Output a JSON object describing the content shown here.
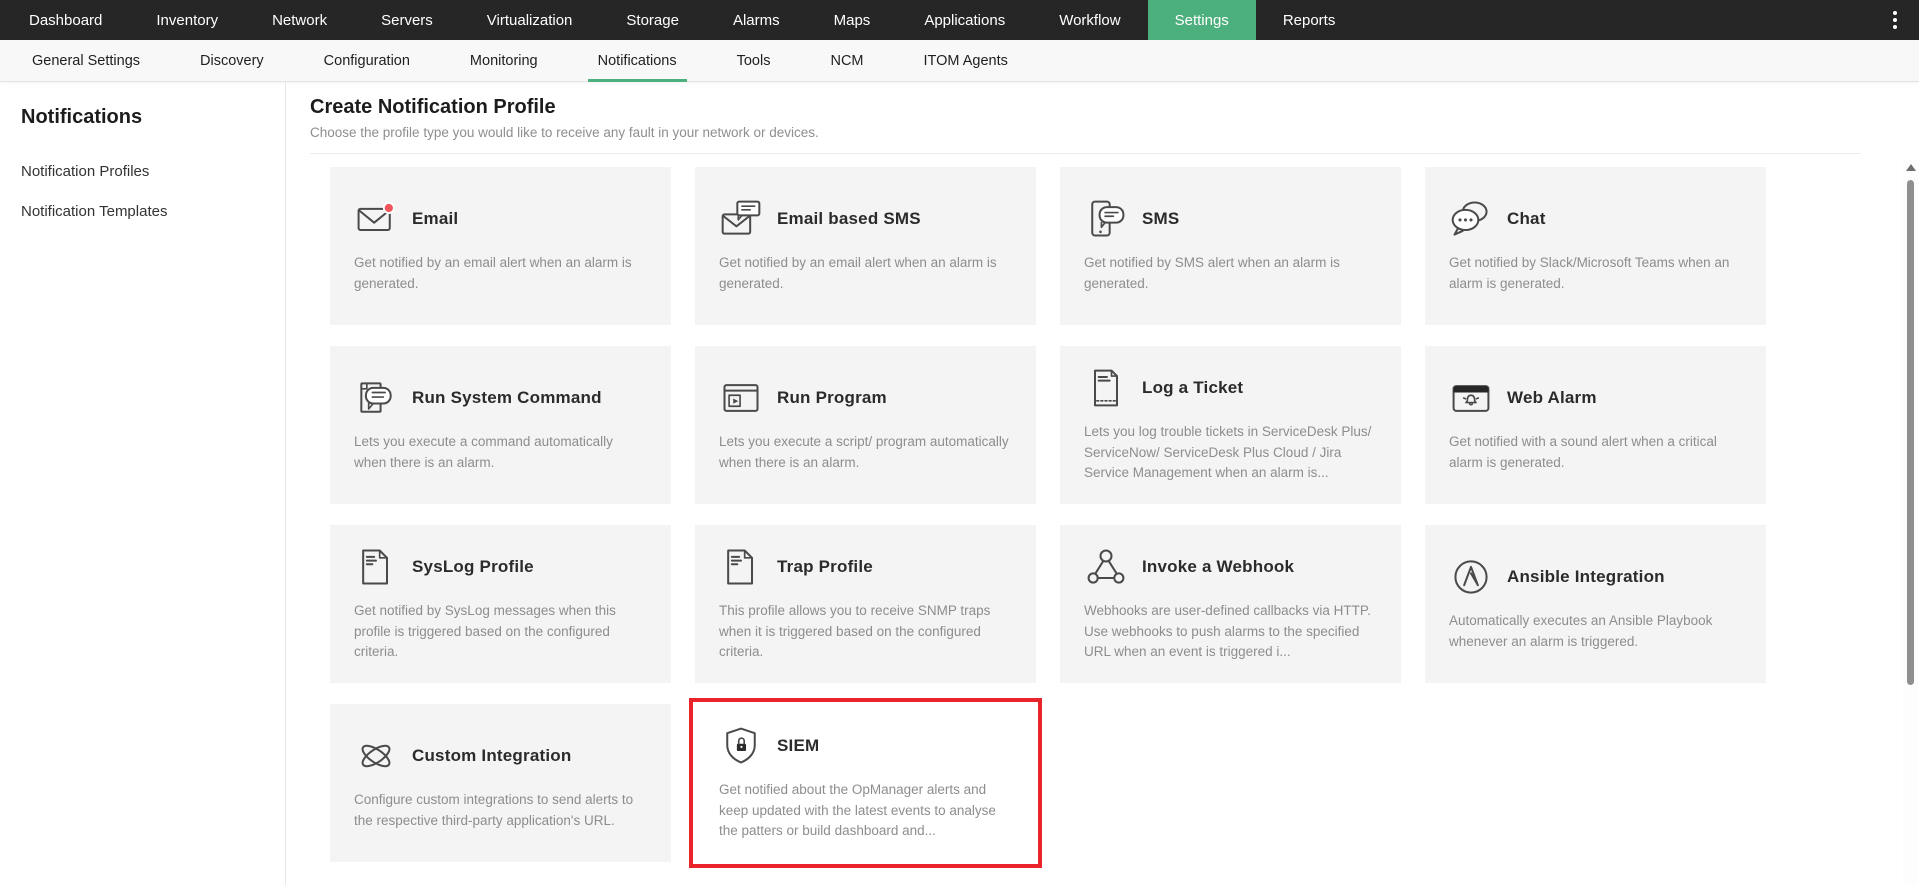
{
  "topnav": {
    "items": [
      {
        "label": "Dashboard",
        "name": "top-nav-item-dashboard"
      },
      {
        "label": "Inventory",
        "name": "top-nav-item-inventory"
      },
      {
        "label": "Network",
        "name": "top-nav-item-network"
      },
      {
        "label": "Servers",
        "name": "top-nav-item-servers"
      },
      {
        "label": "Virtualization",
        "name": "top-nav-item-virtualization"
      },
      {
        "label": "Storage",
        "name": "top-nav-item-storage"
      },
      {
        "label": "Alarms",
        "name": "top-nav-item-alarms"
      },
      {
        "label": "Maps",
        "name": "top-nav-item-maps"
      },
      {
        "label": "Applications",
        "name": "top-nav-item-applications"
      },
      {
        "label": "Workflow",
        "name": "top-nav-item-workflow"
      },
      {
        "label": "Settings",
        "name": "top-nav-item-settings",
        "active": true
      },
      {
        "label": "Reports",
        "name": "top-nav-item-reports"
      }
    ]
  },
  "subnav": {
    "items": [
      {
        "label": "General Settings",
        "name": "sub-nav-item-general-settings"
      },
      {
        "label": "Discovery",
        "name": "sub-nav-item-discovery"
      },
      {
        "label": "Configuration",
        "name": "sub-nav-item-configuration"
      },
      {
        "label": "Monitoring",
        "name": "sub-nav-item-monitoring"
      },
      {
        "label": "Notifications",
        "name": "sub-nav-item-notifications",
        "active": true
      },
      {
        "label": "Tools",
        "name": "sub-nav-item-tools"
      },
      {
        "label": "NCM",
        "name": "sub-nav-item-ncm"
      },
      {
        "label": "ITOM Agents",
        "name": "sub-nav-item-itom-agents"
      }
    ]
  },
  "sidebar": {
    "title": "Notifications",
    "items": [
      {
        "label": "Notification Profiles",
        "name": "sidebar-item-notification-profiles"
      },
      {
        "label": "Notification Templates",
        "name": "sidebar-item-notification-templates"
      }
    ]
  },
  "main": {
    "title": "Create Notification Profile",
    "subtitle": "Choose the profile type you would like to receive any fault in your network or devices.",
    "cards": [
      {
        "title": "Email",
        "icon": "email-icon",
        "name": "card-email",
        "description": "Get notified by an email alert when an alarm is generated."
      },
      {
        "title": "Email based SMS",
        "icon": "email-sms-icon",
        "name": "card-email-based-sms",
        "description": "Get notified by an email alert when an alarm is generated."
      },
      {
        "title": "SMS",
        "icon": "sms-icon",
        "name": "card-sms",
        "description": "Get notified by SMS alert when an alarm is generated."
      },
      {
        "title": "Chat",
        "icon": "chat-icon",
        "name": "card-chat",
        "description": "Get notified by Slack/Microsoft Teams when an alarm is generated."
      },
      {
        "title": "Run System Command",
        "icon": "run-system-command-icon",
        "name": "card-run-system-command",
        "description": "Lets you execute a command automatically when there is an alarm."
      },
      {
        "title": "Run Program",
        "icon": "run-program-icon",
        "name": "card-run-program",
        "description": "Lets you execute a script/ program automatically when there is an alarm."
      },
      {
        "title": "Log a Ticket",
        "icon": "log-ticket-icon",
        "name": "card-log-a-ticket",
        "description": "Lets you log trouble tickets in ServiceDesk Plus/ ServiceNow/ ServiceDesk Plus Cloud / Jira Service Management when an alarm is..."
      },
      {
        "title": "Web Alarm",
        "icon": "web-alarm-icon",
        "name": "card-web-alarm",
        "description": "Get notified with a sound alert when a critical alarm is generated."
      },
      {
        "title": "SysLog Profile",
        "icon": "syslog-icon",
        "name": "card-syslog-profile",
        "description": "Get notified by SysLog messages when this profile is triggered based on the configured criteria."
      },
      {
        "title": "Trap Profile",
        "icon": "trap-icon",
        "name": "card-trap-profile",
        "description": "This profile allows you to receive SNMP traps when it is triggered based on the configured criteria."
      },
      {
        "title": "Invoke a Webhook",
        "icon": "webhook-icon",
        "name": "card-invoke-a-webhook",
        "description": "Webhooks are user-defined callbacks via HTTP. Use webhooks to push alarms to the specified URL when an event is triggered i..."
      },
      {
        "title": "Ansible Integration",
        "icon": "ansible-icon",
        "name": "card-ansible-integration",
        "description": "Automatically executes an Ansible Playbook whenever an alarm is triggered."
      },
      {
        "title": "Custom Integration",
        "icon": "custom-integration-icon",
        "name": "card-custom-integration",
        "description": "Configure custom integrations to send alerts to the respective third-party application's URL."
      },
      {
        "title": "SIEM",
        "icon": "siem-icon",
        "name": "card-siem",
        "highlighted": true,
        "description": "Get notified about the OpManager alerts and keep updated with the latest events to analyse the patters or build dashboard and..."
      }
    ]
  },
  "colors": {
    "accent_green": "#4caf7e",
    "highlight_red": "#e9242a",
    "badge_red": "#f2555a",
    "nav_dark": "#262626"
  }
}
